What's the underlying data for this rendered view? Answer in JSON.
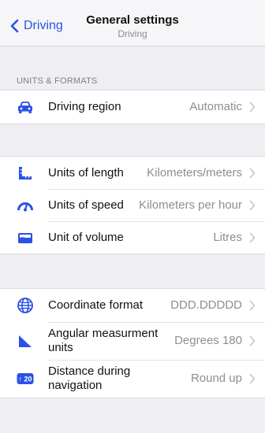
{
  "nav": {
    "back_label": "Driving",
    "title": "General settings",
    "subtitle": "Driving"
  },
  "units_section": {
    "header": "UNITS & FORMATS",
    "driving_region": {
      "label": "Driving region",
      "value": "Automatic",
      "icon": "car-icon"
    }
  },
  "measurement_group": {
    "items": [
      {
        "label": "Units of length",
        "value": "Kilometers/meters",
        "icon": "ruler-icon"
      },
      {
        "label": "Units of speed",
        "value": "Kilometers per hour",
        "icon": "speedometer-icon"
      },
      {
        "label": "Unit of volume",
        "value": "Litres",
        "icon": "fuel-tank-icon"
      }
    ]
  },
  "format_group": {
    "items": [
      {
        "label": "Coordinate format",
        "value": "DDD.DDDDD",
        "icon": "globe-icon"
      },
      {
        "label": "Angular measurment units",
        "value": "Degrees 180",
        "icon": "angle-icon"
      },
      {
        "label": "Distance during navigation",
        "value": "Round up",
        "icon": "distance-badge-icon",
        "badge_text": "↑ 20"
      }
    ]
  },
  "colors": {
    "accent": "#2b51e6",
    "background": "#efeff3",
    "secondary_text": "#8e8e93"
  }
}
